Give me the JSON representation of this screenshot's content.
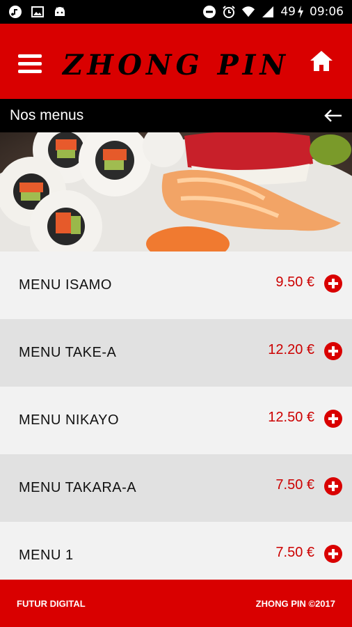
{
  "status_bar": {
    "left_icons": [
      "music-note-icon",
      "image-icon",
      "android-icon"
    ],
    "battery": "49",
    "time": "09:06"
  },
  "app_bar": {
    "brand": "ZHONG PIN"
  },
  "section": {
    "title": "Nos menus"
  },
  "menus": [
    {
      "name": "MENU ISAMO",
      "price": "9.50 €"
    },
    {
      "name": "MENU TAKE-A",
      "price": "12.20 €"
    },
    {
      "name": "MENU NIKAYO",
      "price": "12.50 €"
    },
    {
      "name": "MENU TAKARA-A",
      "price": "7.50 €"
    },
    {
      "name": "MENU 1",
      "price": "7.50 €"
    }
  ],
  "footer": {
    "left": "FUTUR DIGITAL",
    "right": "ZHONG PIN ©2017"
  },
  "colors": {
    "brand_red": "#d90000",
    "price_red": "#cc0000",
    "black": "#000000"
  }
}
